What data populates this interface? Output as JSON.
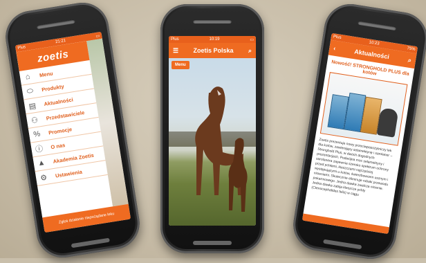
{
  "colors": {
    "accent": "#ef6b21",
    "accent_dark": "#e0601e",
    "background": "#c9bfab"
  },
  "left_phone": {
    "status": {
      "carrier": "Plus",
      "time": "21:21"
    },
    "logo": "zoetis",
    "menu_items": [
      {
        "label": "Menu",
        "icon": "home-icon"
      },
      {
        "label": "Produkty",
        "icon": "pill-icon"
      },
      {
        "label": "Aktualności",
        "icon": "news-icon"
      },
      {
        "label": "Przedstawiciele",
        "icon": "people-icon"
      },
      {
        "label": "Promocje",
        "icon": "percent-icon"
      },
      {
        "label": "O nas",
        "icon": "info-icon"
      },
      {
        "label": "Akademia Zoetis",
        "icon": "graduation-cap-icon"
      },
      {
        "label": "Ustawienia",
        "icon": "gear-icon"
      }
    ],
    "footer_text": "Zgłoś działanie niepożądane leku"
  },
  "center_phone": {
    "status": {
      "carrier": "Plus",
      "time": "10:19"
    },
    "title": "Zoetis Polska",
    "menu_tag": "Menu"
  },
  "right_phone": {
    "status": {
      "carrier": "Plus",
      "time": "10:23",
      "battery": "75%"
    },
    "title": "Aktualności",
    "article_title": "Nowość! STRONGHOLD PLUS dla kotów",
    "article_body": "Zoetis prezentuje nowy przeciwpasożytniczy lek dla kotów, zawierający selamektynę i sarolaner – Stronghold Plus, w dwóch dogodnych prezentacjach. Podwójna moc selamektyny i sarolanera zapewnia szeroko spektrum ochrony przed pchłami, kleszczami najczęściej występującymi u kotów, świerzbowcem usznym i nicieniami. Skutecznie eliminuje robaki przewodu pokarmowego. Jedna dawka zwalcza nicienie. Jedna dawka zabija kleszcze pchły (Ctenocephalides felis) w ciągu"
  }
}
